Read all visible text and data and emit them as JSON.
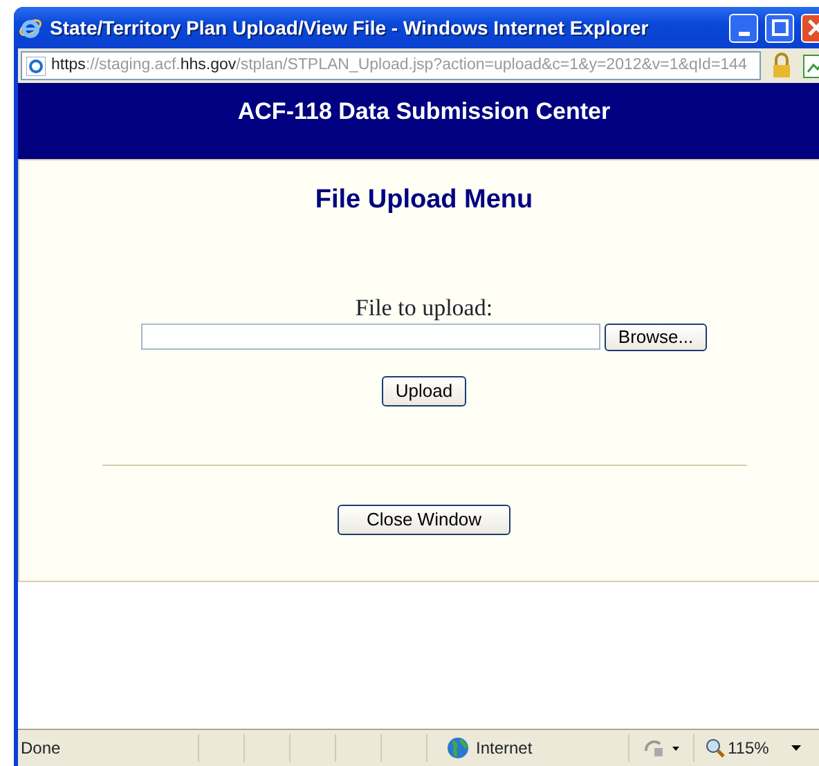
{
  "window": {
    "title": "State/Territory Plan Upload/View File - Windows Internet Explorer"
  },
  "address_bar": {
    "url_parts": [
      {
        "text": "https",
        "highlight": true
      },
      {
        "text": "://staging.acf.",
        "highlight": false
      },
      {
        "text": "hhs.gov",
        "highlight": true
      },
      {
        "text": "/stplan/STPLAN_Upload.jsp?action=upload&c=1&y=2012&v=1&qId=144",
        "highlight": false
      }
    ]
  },
  "header": {
    "title": "ACF-118 Data Submission Center"
  },
  "page": {
    "heading": "File Upload Menu",
    "file_label": "File to upload:",
    "browse_button": "Browse...",
    "upload_button": "Upload",
    "close_button": "Close Window"
  },
  "status_bar": {
    "status": "Done",
    "zone": "Internet",
    "zoom": "115%"
  }
}
